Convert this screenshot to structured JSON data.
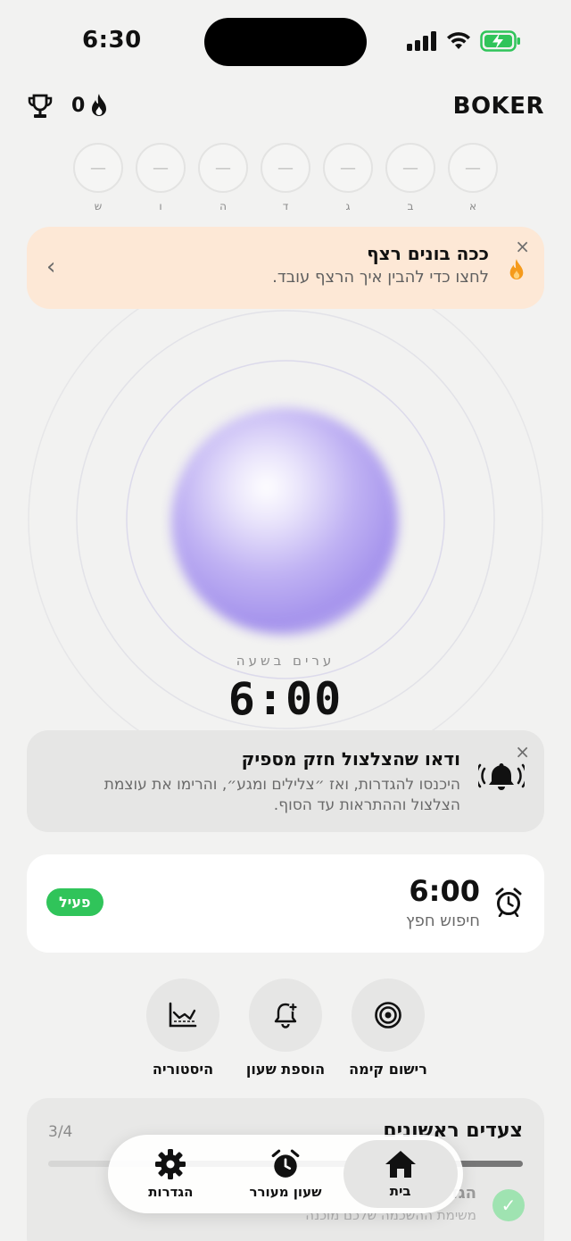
{
  "status_bar": {
    "time": "6:30"
  },
  "header": {
    "app_title": "BOKER",
    "streak_count": "0"
  },
  "week": {
    "days": [
      {
        "label": "א",
        "mark": "—"
      },
      {
        "label": "ב",
        "mark": "—"
      },
      {
        "label": "ג",
        "mark": "—"
      },
      {
        "label": "ד",
        "mark": "—"
      },
      {
        "label": "ה",
        "mark": "—"
      },
      {
        "label": "ו",
        "mark": "—"
      },
      {
        "label": "ש",
        "mark": "—"
      }
    ]
  },
  "streak_banner": {
    "title": "ככה בונים רצף",
    "subtitle": "לחצו כדי להבין איך הרצף עובד.",
    "close": "×",
    "chevron": "‹"
  },
  "wake": {
    "label": "ערים בשעה",
    "time": "6:00"
  },
  "volume_card": {
    "title": "ודאו שהצלצול חזק מספיק",
    "body": "היכנסו להגדרות, ואז ״צלילים ומגע״, והרימו את עוצמת הצלצול וההתראות עד הסוף.",
    "close": "×"
  },
  "alarm": {
    "time": "6:00",
    "mission": "חיפוש חפץ",
    "status": "פעיל"
  },
  "quick_actions": [
    {
      "label": "רישום קימה",
      "icon": "target-icon"
    },
    {
      "label": "הוספת שעון",
      "icon": "bell-plus-icon"
    },
    {
      "label": "היסטוריה",
      "icon": "history-chart-icon"
    }
  ],
  "steps": {
    "title": "צעדים ראשונים",
    "progress_text": "3/4",
    "progress": 0.75,
    "item_title": "הגדירו את שעון",
    "item_sub": "משימת ההשכמה שלכם מוכנה",
    "check": "✓"
  },
  "tabbar": [
    {
      "label": "בית",
      "icon": "home-icon",
      "active": true
    },
    {
      "label": "שעון מעורר",
      "icon": "alarm-clock-icon",
      "active": false
    },
    {
      "label": "הגדרות",
      "icon": "gear-icon",
      "active": false
    }
  ],
  "colors": {
    "accent_green": "#30c45a",
    "banner_bg": "#fde8d6",
    "orb": "#a492ec",
    "flame": "#f59a1b"
  }
}
